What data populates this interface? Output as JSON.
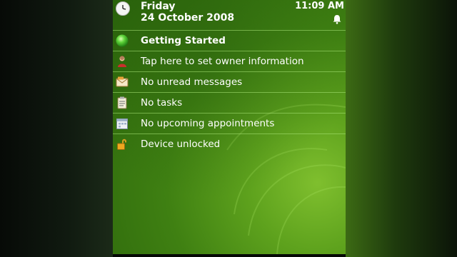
{
  "header": {
    "day": "Friday",
    "date": "24 October 2008",
    "time": "11:09 AM"
  },
  "items": [
    {
      "label": "Getting Started",
      "icon": "green-orb-icon"
    },
    {
      "label": "Tap here to set owner information",
      "icon": "owner-person-icon"
    },
    {
      "label": "No unread messages",
      "icon": "envelope-icon"
    },
    {
      "label": "No tasks",
      "icon": "clipboard-icon"
    },
    {
      "label": "No upcoming appointments",
      "icon": "calendar-icon"
    },
    {
      "label": "Device unlocked",
      "icon": "padlock-unlocked-icon"
    }
  ],
  "colors": {
    "screen_green": "#3f8012",
    "highlight_green": "#7fbf2e",
    "text": "#ffffff"
  }
}
